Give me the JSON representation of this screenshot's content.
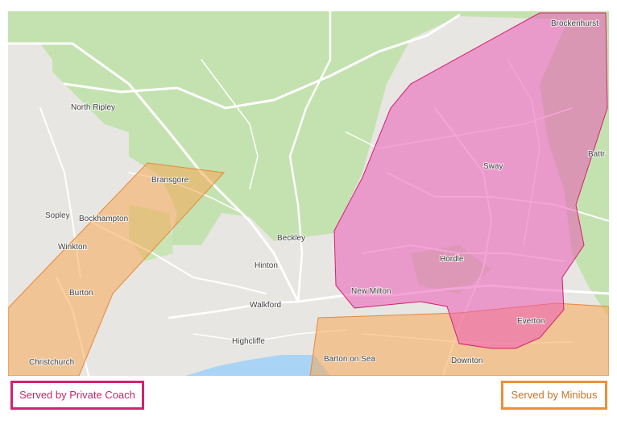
{
  "map": {
    "places": [
      {
        "id": "brockenhurst",
        "label": "Brockenhurst"
      },
      {
        "id": "north-ripley",
        "label": "North Ripley"
      },
      {
        "id": "battramsley",
        "label": "Battr"
      },
      {
        "id": "bransgore",
        "label": "Bransgore"
      },
      {
        "id": "sway",
        "label": "Sway"
      },
      {
        "id": "sopley",
        "label": "Sopley"
      },
      {
        "id": "bockhampton",
        "label": "Bockhampton"
      },
      {
        "id": "beckley",
        "label": "Beckley"
      },
      {
        "id": "winkton",
        "label": "Winkton"
      },
      {
        "id": "hinton",
        "label": "Hinton"
      },
      {
        "id": "hordle",
        "label": "Hordle"
      },
      {
        "id": "burton",
        "label": "Burton"
      },
      {
        "id": "new-milton",
        "label": "New Milton"
      },
      {
        "id": "walkford",
        "label": "Walkford"
      },
      {
        "id": "everton",
        "label": "Everton"
      },
      {
        "id": "highcliffe",
        "label": "Highcliffe"
      },
      {
        "id": "barton-on-sea",
        "label": "Barton on Sea"
      },
      {
        "id": "downton",
        "label": "Downton"
      },
      {
        "id": "christchurch",
        "label": "Christchurch"
      }
    ]
  },
  "legend": {
    "coach": {
      "label": "Served by Private Coach",
      "color": "#d3226f"
    },
    "minibus": {
      "label": "Served by Minibus",
      "color": "#ed8f3a"
    }
  },
  "colors": {
    "land": "#e7e6e2",
    "forest": "#c4e2b0",
    "sea": "#a9d4f5",
    "coach_fill": "#ec5ab8",
    "minibus_fill": "#f7a855"
  }
}
